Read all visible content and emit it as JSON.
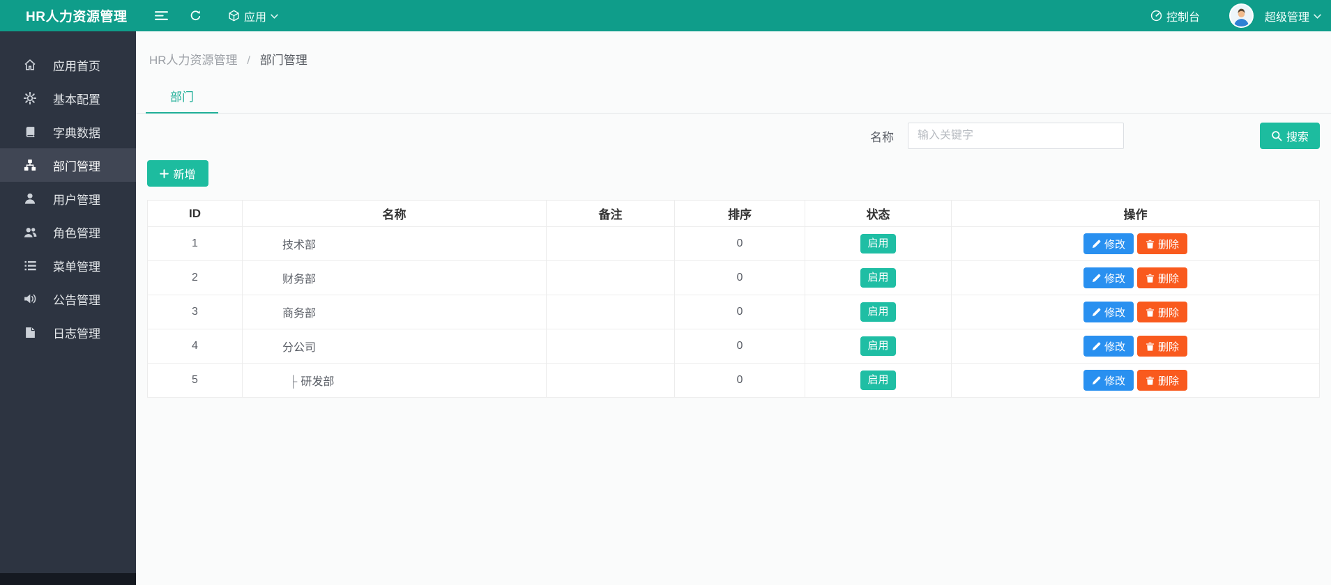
{
  "app": {
    "title": "HR人力资源管理"
  },
  "header": {
    "app_menu_label": "应用",
    "console_label": "控制台",
    "user_name": "超级管理"
  },
  "sidebar": {
    "items": [
      {
        "key": "home",
        "icon": "home-icon",
        "label": "应用首页",
        "active": false
      },
      {
        "key": "basic-config",
        "icon": "gear-icon",
        "label": "基本配置",
        "active": false
      },
      {
        "key": "dict-data",
        "icon": "book-icon",
        "label": "字典数据",
        "active": false
      },
      {
        "key": "dept-mgmt",
        "icon": "sitemap-icon",
        "label": "部门管理",
        "active": true
      },
      {
        "key": "user-mgmt",
        "icon": "user-icon",
        "label": "用户管理",
        "active": false
      },
      {
        "key": "role-mgmt",
        "icon": "users-icon",
        "label": "角色管理",
        "active": false
      },
      {
        "key": "menu-mgmt",
        "icon": "menu-list-icon",
        "label": "菜单管理",
        "active": false
      },
      {
        "key": "notice-mgmt",
        "icon": "speaker-icon",
        "label": "公告管理",
        "active": false
      },
      {
        "key": "log-mgmt",
        "icon": "file-icon",
        "label": "日志管理",
        "active": false
      }
    ]
  },
  "breadcrumb": {
    "root": "HR人力资源管理",
    "separator": "/",
    "current": "部门管理"
  },
  "tabs": [
    {
      "label": "部门",
      "active": true
    }
  ],
  "search": {
    "label": "名称",
    "placeholder": "输入关键字",
    "button_label": "搜索"
  },
  "toolbar": {
    "add_label": "新增"
  },
  "table": {
    "columns": [
      {
        "key": "id",
        "label": "ID"
      },
      {
        "key": "name",
        "label": "名称"
      },
      {
        "key": "remark",
        "label": "备注"
      },
      {
        "key": "sort",
        "label": "排序"
      },
      {
        "key": "status",
        "label": "状态"
      },
      {
        "key": "actions",
        "label": "操作"
      }
    ],
    "actions": {
      "edit": "修改",
      "delete": "删除"
    },
    "rows": [
      {
        "id": "1",
        "name": "技术部",
        "remark": "",
        "sort": "0",
        "status": "启用",
        "is_child": false,
        "tree_prefix": ""
      },
      {
        "id": "2",
        "name": "财务部",
        "remark": "",
        "sort": "0",
        "status": "启用",
        "is_child": false,
        "tree_prefix": ""
      },
      {
        "id": "3",
        "name": "商务部",
        "remark": "",
        "sort": "0",
        "status": "启用",
        "is_child": false,
        "tree_prefix": ""
      },
      {
        "id": "4",
        "name": "分公司",
        "remark": "",
        "sort": "0",
        "status": "启用",
        "is_child": false,
        "tree_prefix": ""
      },
      {
        "id": "5",
        "name": "研发部",
        "remark": "",
        "sort": "0",
        "status": "启用",
        "is_child": true,
        "tree_prefix": "├"
      }
    ]
  },
  "colors": {
    "header_teal": "#0f9d8a",
    "button_teal": "#1dbc9f",
    "status_badge_teal": "#1fbea4",
    "edit_blue": "#2990f0",
    "delete_orange": "#f95a1e",
    "sidebar_dark": "#2d3441",
    "sidebar_active": "#404654",
    "tab_teal": "#1fae97"
  }
}
